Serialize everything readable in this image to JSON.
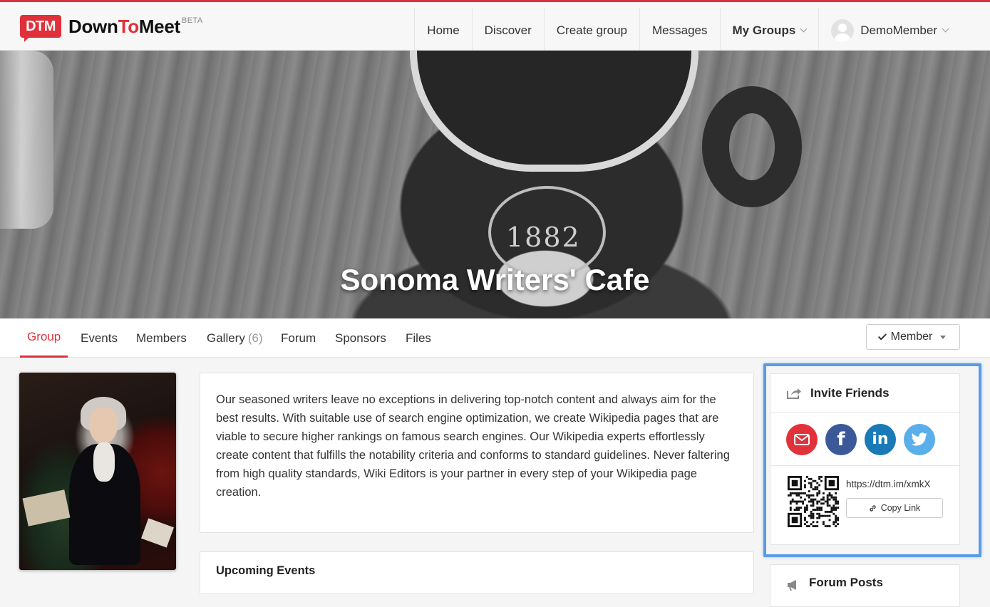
{
  "brand": {
    "mark": "DTM",
    "name_part1": "Down",
    "name_part2": "To",
    "name_part3": "Meet",
    "beta": "BETA"
  },
  "nav": {
    "items": [
      "Home",
      "Discover",
      "Create group",
      "Messages"
    ],
    "my_groups": "My Groups",
    "user": "DemoMember"
  },
  "hero": {
    "title": "Sonoma Writers' Cafe",
    "cup_number": "1882"
  },
  "tabs": {
    "group": "Group",
    "events": "Events",
    "members": "Members",
    "gallery": "Gallery",
    "gallery_count": "(6)",
    "forum": "Forum",
    "sponsors": "Sponsors",
    "files": "Files"
  },
  "membership": {
    "label": "Member"
  },
  "description": "Our seasoned writers leave no exceptions in delivering top-notch content and always aim for the best results. With suitable use of search engine optimization, we create Wikipedia pages that are viable to secure higher rankings on famous search engines. Our Wikipedia experts effortlessly create content that fulfills the notability criteria and conforms to standard guidelines. Never faltering from high quality standards, Wiki Editors is your partner in every step of your Wikipedia page creation.",
  "upcoming": {
    "title": "Upcoming Events"
  },
  "invite": {
    "title": "Invite Friends",
    "social": [
      "mail-icon",
      "facebook-icon",
      "linkedin-icon",
      "twitter-icon"
    ],
    "link": "https://dtm.im/xmkX",
    "copy_label": "Copy Link"
  },
  "forum_posts": {
    "title": "Forum Posts"
  },
  "colors": {
    "accent": "#d9333f",
    "highlight": "#5a9be8",
    "mail": "#e1323c",
    "facebook": "#3b5998",
    "linkedin": "#1a7ab8",
    "twitter": "#5aaeea"
  }
}
